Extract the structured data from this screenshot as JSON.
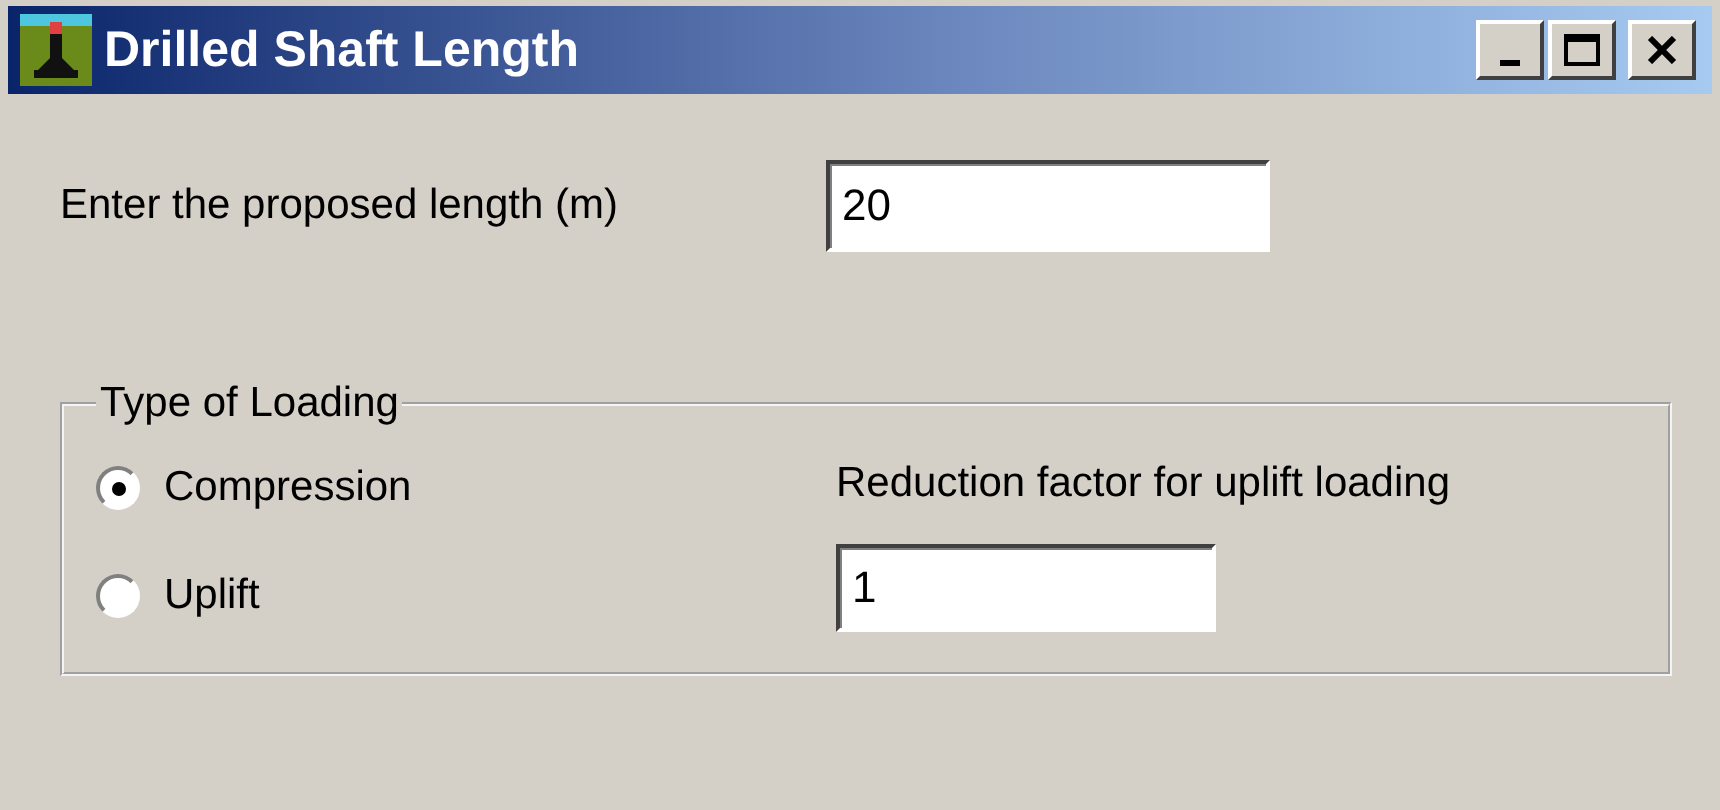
{
  "window": {
    "title": "Drilled Shaft Length"
  },
  "length_field": {
    "label": "Enter the proposed length (m)",
    "value": "20"
  },
  "loading_group": {
    "title": "Type of Loading",
    "options": [
      {
        "label": "Compression",
        "selected": true
      },
      {
        "label": "Uplift",
        "selected": false
      }
    ],
    "reduction_field": {
      "label": "Reduction factor for uplift loading",
      "value": "1"
    }
  }
}
